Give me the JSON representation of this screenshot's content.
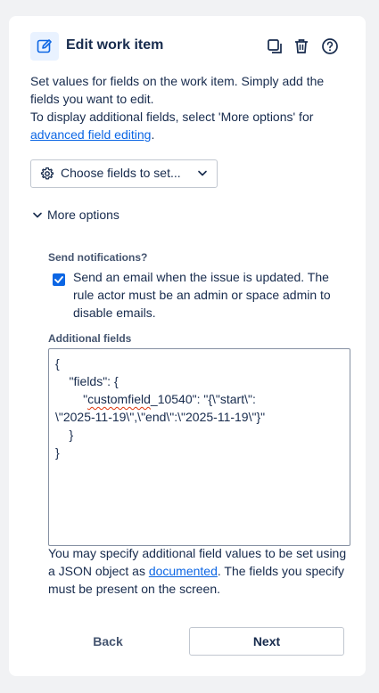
{
  "header": {
    "title": "Edit work item",
    "icon": "edit-pencil-icon",
    "actions": [
      "duplicate-icon",
      "trash-icon",
      "help-icon"
    ]
  },
  "description": {
    "line1": "Set values for fields on the work item. Simply add the fields you want to edit.",
    "line2": "To display additional fields, select 'More options' for",
    "link": "advanced field editing",
    "after_link": "."
  },
  "choose_fields": {
    "label": "Choose fields to set..."
  },
  "more_options": {
    "label": "More options"
  },
  "notifications": {
    "label": "Send notifications?",
    "checked": true,
    "text": "Send an email when the issue is updated. The rule actor must be an admin or space admin to disable emails."
  },
  "additional_fields": {
    "label": "Additional fields",
    "lines": [
      "{",
      "    \"fields\": {",
      "        \"",
      "customfield",
      "_10540\": \"{\\\"start\\\":",
      "\\\"2025-11-19\\\",\\\"end\\\":\\\"2025-11-19\\\"}\"",
      "    }",
      "}"
    ]
  },
  "help": {
    "before": "You may specify additional field values to be set using a JSON object as ",
    "link": "documented",
    "after": ". The fields you specify must be present on the screen."
  },
  "footer": {
    "back": "Back",
    "next": "Next"
  },
  "colors": {
    "accent": "#0c66e4",
    "icon_bg": "#e9f2ff",
    "text": "#172b4d"
  }
}
